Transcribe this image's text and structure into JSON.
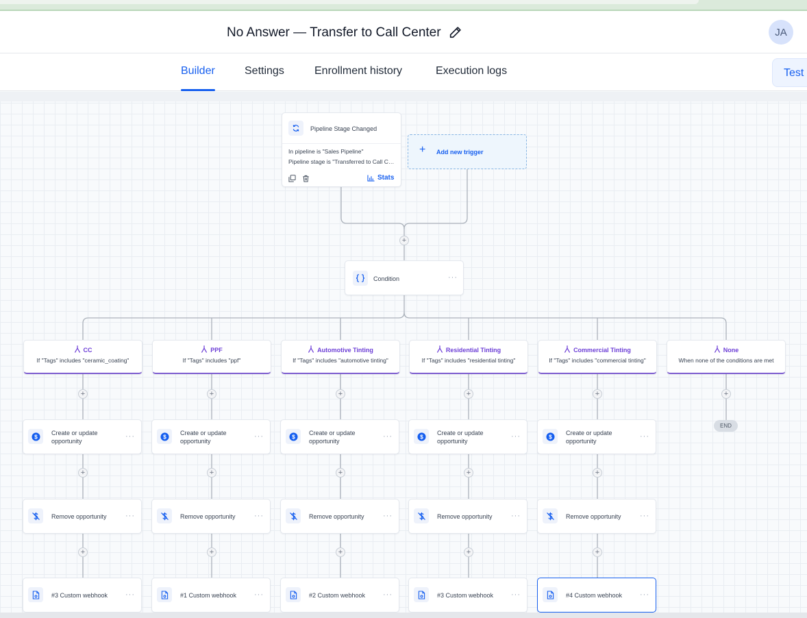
{
  "header": {
    "workflow_title": "No Answer — Transfer to Call Center",
    "avatar_initials": "JA"
  },
  "tabs": [
    {
      "label": "Builder",
      "active": true
    },
    {
      "label": "Settings",
      "active": false
    },
    {
      "label": "Enrollment history",
      "active": false
    },
    {
      "label": "Execution logs",
      "active": false
    }
  ],
  "test_button": "Test",
  "trigger": {
    "title": "Pipeline Stage Changed",
    "conditions": [
      "In pipeline is \"Sales Pipeline\"",
      "Pipeline stage is \"Transferred to Call Center\""
    ],
    "stats_label": "Stats"
  },
  "add_trigger_label": "Add new trigger",
  "condition_node": {
    "label": "Condition"
  },
  "branches": [
    {
      "name": "CC",
      "desc": "If \"Tags\" includes \"ceramic_coating\""
    },
    {
      "name": "PPF",
      "desc": "If \"Tags\" includes \"ppf\""
    },
    {
      "name": "Automotive Tinting",
      "desc": "If \"Tags\" includes \"automotive tinting\""
    },
    {
      "name": "Residential Tinting",
      "desc": "If \"Tags\" includes \"residential tinting\""
    },
    {
      "name": "Commercial Tinting",
      "desc": "If \"Tags\" includes \"commercial tinting\""
    },
    {
      "name": "None",
      "desc": "When none of the conditions are met"
    }
  ],
  "actions": {
    "opportunity_line1": "Create or update",
    "opportunity_line2": "opportunity",
    "remove": "Remove opportunity",
    "webhooks": [
      "#3 Custom webhook",
      "#1 Custom webhook",
      "#2 Custom webhook",
      "#3 Custom webhook",
      "#4 Custom webhook"
    ]
  },
  "end_label": "END",
  "plus_symbol": "+",
  "more_symbol": "···",
  "icons": {
    "trigger": "refresh-icon",
    "condition": "braces-icon",
    "branch": "branch-icon",
    "opportunity": "dollar-icon",
    "remove": "remove-opportunity-icon",
    "webhook": "webhook-icon",
    "edit": "pencil-icon",
    "copy": "copy-icon",
    "delete": "trash-icon",
    "stats": "bar-chart-icon"
  },
  "colors": {
    "primary": "#155eef",
    "branch_accent": "#6d3fd6",
    "dollar_icon": "#155eef"
  }
}
